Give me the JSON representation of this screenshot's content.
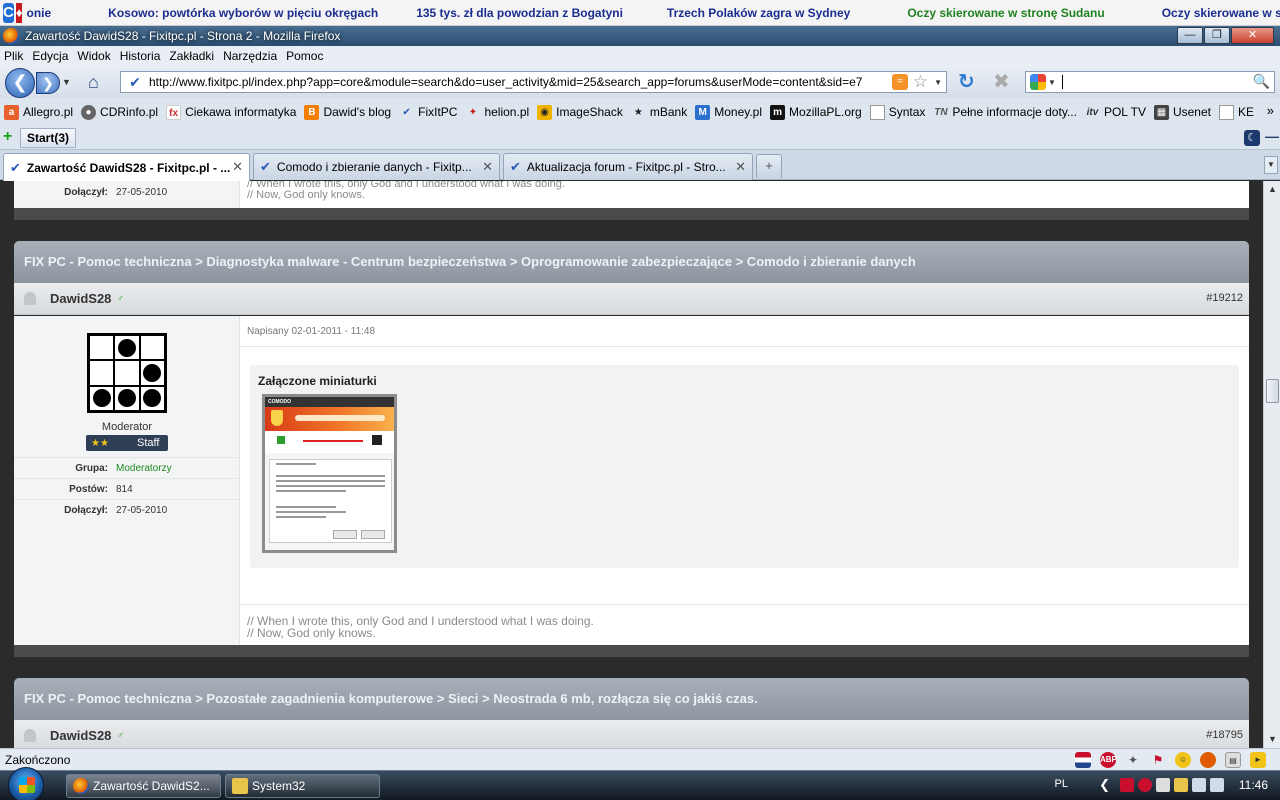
{
  "ticker": {
    "first": "onie",
    "items": [
      {
        "text": "Kosowo: powtórka wyborów w pięciu okręgach",
        "color": "#1b2d8f"
      },
      {
        "text": "135 tys. zł dla powodzian z Bogatyni",
        "color": "#1b2d8f"
      },
      {
        "text": "Trzech Polaków zagra w Sydney",
        "color": "#1b2d8f"
      },
      {
        "text": "Oczy skierowane w stronę Sudanu",
        "color": "#208220"
      },
      {
        "text": "Oczy skierowane w stronę Sudanu",
        "color": "#1b2d8f"
      }
    ]
  },
  "window": {
    "title": "Zawartość DawidS28 - Fixitpc.pl - Strona 2 - Mozilla Firefox"
  },
  "menu": [
    "Plik",
    "Edycja",
    "Widok",
    "Historia",
    "Zakładki",
    "Narzędzia",
    "Pomoc"
  ],
  "navbar": {
    "url": "http://www.fixitpc.pl/index.php?app=core&module=search&do=user_activity&mid=25&search_app=forums&userMode=content&sid=e7",
    "search_value": ""
  },
  "bookmarks": [
    {
      "label": "Allegro.pl",
      "icon": "allegro-icon",
      "color": "#e8612c"
    },
    {
      "label": "CDRinfo.pl",
      "icon": "cdrinfo-icon",
      "color": "#666666"
    },
    {
      "label": "Ciekawa informatyka",
      "icon": "fx-icon",
      "color": "#c9302c"
    },
    {
      "label": "Dawid's blog",
      "icon": "blogger-icon",
      "color": "#f57d00"
    },
    {
      "label": "FixItPC",
      "icon": "fixitpc-icon",
      "color": "#2a5ab8"
    },
    {
      "label": "helion.pl",
      "icon": "helion-icon",
      "color": "#c8191e"
    },
    {
      "label": "ImageShack",
      "icon": "imageshack-icon",
      "color": "#f0b400"
    },
    {
      "label": "mBank",
      "icon": "mbank-icon",
      "color": "#333333"
    },
    {
      "label": "Money.pl",
      "icon": "money-icon",
      "color": "#2b6fcf"
    },
    {
      "label": "MozillaPL.org",
      "icon": "mozillapl-icon",
      "color": "#111111"
    },
    {
      "label": "Syntax",
      "icon": "page-icon",
      "color": "#ffffff"
    },
    {
      "label": "Pełne informacje doty...",
      "icon": "tn-icon",
      "color": "#555555"
    },
    {
      "label": "POL TV",
      "icon": "itv-icon",
      "color": "#333333"
    },
    {
      "label": "Usenet",
      "icon": "usenet-icon",
      "color": "#444444"
    },
    {
      "label": "KE",
      "icon": "page-icon",
      "color": "#ffffff"
    }
  ],
  "startbar": {
    "start_label": "Start(3)"
  },
  "tabs": [
    {
      "label": "Zawartość DawidS28 - Fixitpc.pl - ..."
    },
    {
      "label": "Comodo i zbieranie danych - Fixitp..."
    },
    {
      "label": "Aktualizacja forum - Fixitpc.pl - Stro..."
    }
  ],
  "page": {
    "prev_post": {
      "joined_label": "Dołączył:",
      "joined_value": "27-05-2010",
      "signature_line1": "// When I wrote this, only God and I understood what I was doing.",
      "signature_line2": "// Now, God only knows."
    },
    "post": {
      "breadcrumb": "FIX PC - Pomoc techniczna > Diagnostyka malware - Centrum bezpieczeństwa > Oprogramowanie zabezpieczające > Comodo i zbieranie danych",
      "author": "DawidS28",
      "post_number": "#19212",
      "posted": "Napisany 02-01-2011 - 11:48",
      "role": "Moderator",
      "badge": "Staff",
      "group_label": "Grupa:",
      "group_value": "Moderatorzy",
      "posts_label": "Postów:",
      "posts_value": "814",
      "joined_label": "Dołączył:",
      "joined_value": "27-05-2010",
      "attachments_title": "Załączone miniaturki",
      "thumb_header": "COMODO",
      "signature_line1": "// When I wrote this, only God and I understood what I was doing.",
      "signature_line2": "// Now, God only knows."
    },
    "next_post": {
      "breadcrumb": "FIX PC - Pomoc techniczna > Pozostałe zagadnienia komputerowe > Sieci > Neostrada 6 mb, rozłącza się co jakiś czas.",
      "author": "DawidS28",
      "post_number": "#18795"
    }
  },
  "status": {
    "text": "Zakończono"
  },
  "taskbar": {
    "tasks": [
      "Zawartość DawidS2...",
      "System32"
    ],
    "lang": "PL",
    "clock": "11:46"
  }
}
